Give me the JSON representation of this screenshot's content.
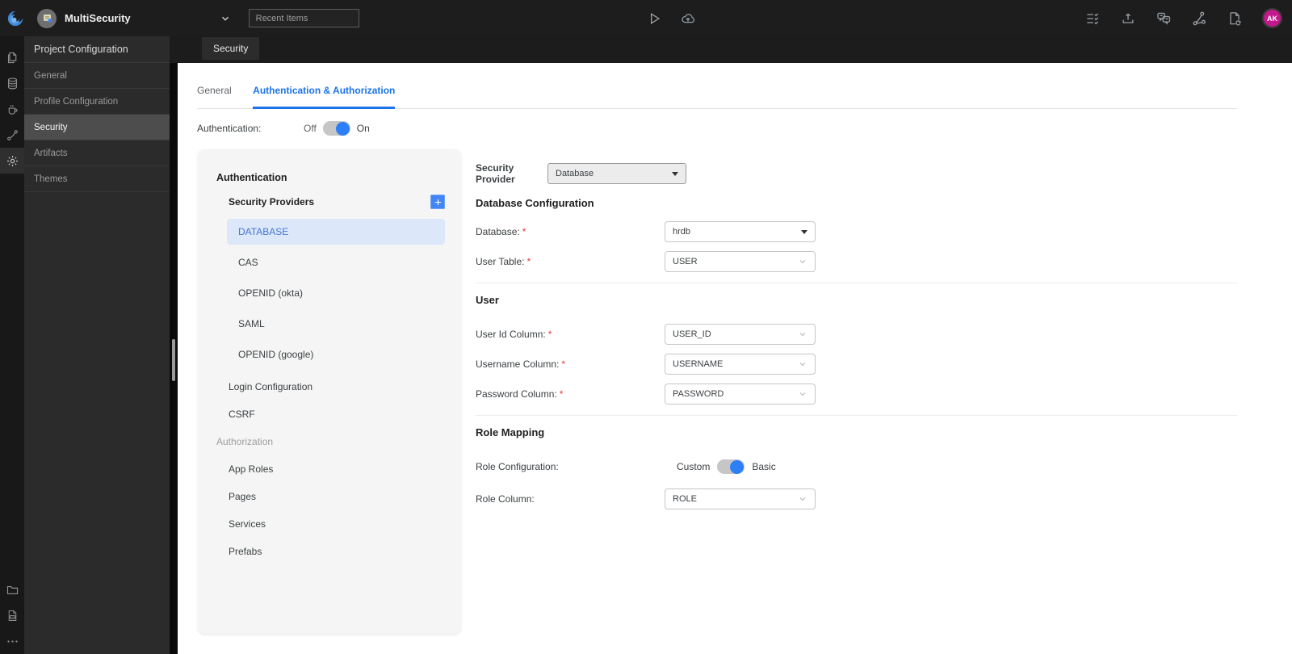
{
  "topbar": {
    "project_name": "MultiSecurity",
    "recent_items_placeholder": "Recent Items",
    "avatar_initials": "AK"
  },
  "tabstrip": {
    "tab_label": "Security"
  },
  "sidebar": {
    "title": "Project Configuration",
    "items": [
      {
        "label": "General",
        "active": false
      },
      {
        "label": "Profile Configuration",
        "active": false
      },
      {
        "label": "Security",
        "active": true
      },
      {
        "label": "Artifacts",
        "active": false
      },
      {
        "label": "Themes",
        "active": false
      }
    ]
  },
  "content": {
    "tabs": [
      {
        "label": "General",
        "active": false
      },
      {
        "label": "Authentication & Authorization",
        "active": true
      }
    ],
    "authentication": {
      "label": "Authentication:",
      "off": "Off",
      "on": "On",
      "state": "on"
    }
  },
  "panel": {
    "auth_header": "Authentication",
    "providers_label": "Security Providers",
    "providers": [
      {
        "label": "DATABASE",
        "active": true
      },
      {
        "label": "CAS",
        "active": false
      },
      {
        "label": "OPENID (okta)",
        "active": false
      },
      {
        "label": "SAML",
        "active": false
      },
      {
        "label": "OPENID (google)",
        "active": false
      }
    ],
    "auth_items": [
      {
        "label": "Login Configuration"
      },
      {
        "label": "CSRF"
      }
    ],
    "authz_header": "Authorization",
    "authz_items": [
      {
        "label": "App Roles"
      },
      {
        "label": "Pages"
      },
      {
        "label": "Services"
      },
      {
        "label": "Prefabs"
      }
    ]
  },
  "form": {
    "required_marker": "*",
    "security_provider": {
      "label": "Security Provider",
      "value": "Database"
    },
    "db_section": {
      "heading": "Database Configuration",
      "database": {
        "label": "Database:",
        "value": "hrdb"
      },
      "user_table": {
        "label": "User Table:",
        "value": "USER"
      }
    },
    "user_section": {
      "heading": "User",
      "user_id": {
        "label": "User Id Column:",
        "value": "USER_ID"
      },
      "username": {
        "label": "Username Column:",
        "value": "USERNAME"
      },
      "password": {
        "label": "Password Column:",
        "value": "PASSWORD"
      }
    },
    "role_section": {
      "heading": "Role Mapping",
      "role_config": {
        "label": "Role Configuration:",
        "left": "Custom",
        "right": "Basic",
        "state": "basic"
      },
      "role_column": {
        "label": "Role Column:",
        "value": "ROLE"
      }
    }
  },
  "colors": {
    "accent_blue": "#1a73e8",
    "toggle_blue": "#2d7ff9",
    "selected_item_bg": "#dce7f9",
    "selected_item_text": "#4478d1",
    "avatar_bg": "#c2188c",
    "required_red": "#e53935",
    "plus_button_blue": "#4285f4"
  }
}
